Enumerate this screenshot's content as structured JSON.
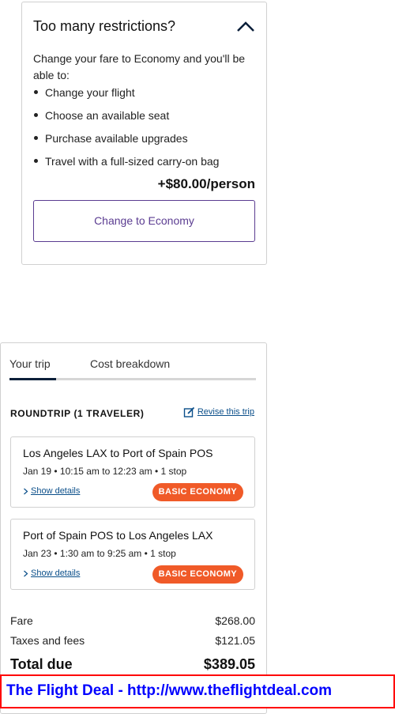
{
  "restrictions": {
    "title": "Too many restrictions?",
    "intro": "Change your fare to Economy and you'll be able to:",
    "benefits": [
      "Change your flight",
      "Choose an available seat",
      "Purchase available upgrades",
      "Travel with a full-sized carry-on bag"
    ],
    "price": "+$80.00/person",
    "button_label": "Change to Economy",
    "accent": "#5b3c91"
  },
  "trip": {
    "tabs": [
      "Your trip",
      "Cost breakdown"
    ],
    "heading": "ROUNDTRIP (1 TRAVELER)",
    "revise_label": "Revise this trip",
    "legs": [
      {
        "route": "Los Angeles LAX to Port of Spain POS",
        "times": "Jan 19 • 10:15 am to 12:23 am • 1 stop",
        "details_label": "Show details",
        "badge": "BASIC ECONOMY"
      },
      {
        "route": "Port of Spain POS to Los Angeles LAX",
        "times": "Jan 23 • 1:30 am to 9:25 am • 1 stop",
        "details_label": "Show details",
        "badge": "BASIC ECONOMY"
      }
    ],
    "costs": {
      "fare_label": "Fare",
      "fare": "$268.00",
      "taxes_label": "Taxes and fees",
      "taxes": "$121.05",
      "total_label": "Total due",
      "total": "$389.05"
    },
    "badge_color": "#f05a28"
  },
  "banner": {
    "text": "The Flight Deal - http://www.theflightdeal.com"
  }
}
